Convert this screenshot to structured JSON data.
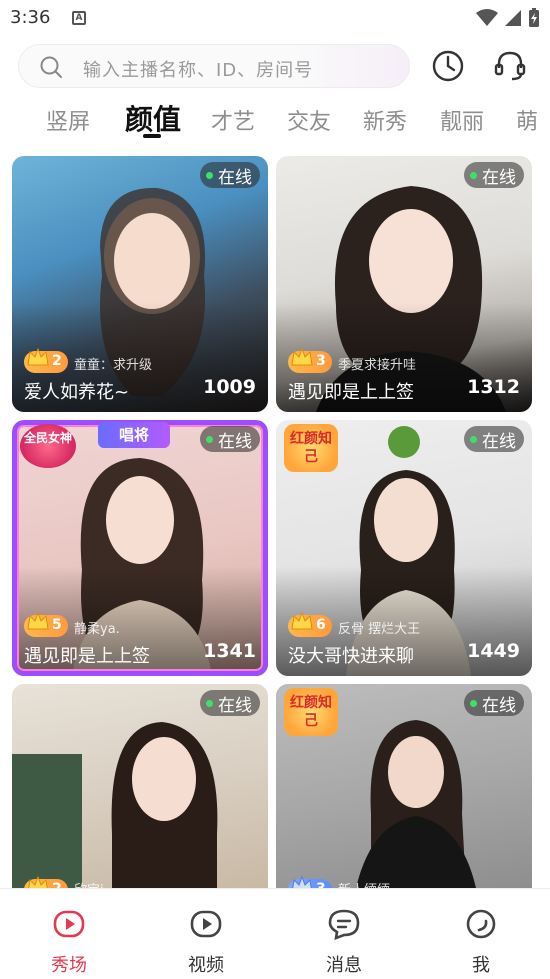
{
  "status": {
    "time": "3:36",
    "notif_icon": "A"
  },
  "search": {
    "placeholder": "输入主播名称、ID、房间号"
  },
  "tabs": [
    {
      "label": "竖屏",
      "active": false
    },
    {
      "label": "颜值",
      "active": true
    },
    {
      "label": "才艺",
      "active": false
    },
    {
      "label": "交友",
      "active": false
    },
    {
      "label": "新秀",
      "active": false
    },
    {
      "label": "靓丽",
      "active": false
    },
    {
      "label": "萌",
      "active": false
    }
  ],
  "cards": [
    {
      "online": "在线",
      "level": "2",
      "subtitle": "童童：求升级",
      "title": "爱人如养花~",
      "count": "1009"
    },
    {
      "online": "在线",
      "level": "3",
      "subtitle": "季夏求接升哇",
      "title": "遇见即是上上签",
      "count": "1312"
    },
    {
      "online": "在线",
      "level": "5",
      "subtitle": "静柔ya.",
      "title": "遇见即是上上签",
      "count": "1341",
      "tag_left": "全民女神",
      "tag_center": "唱将"
    },
    {
      "online": "在线",
      "level": "6",
      "subtitle": "反骨 摆烂大王",
      "title": "没大哥快进来聊",
      "count": "1449",
      "tag_left": "红颜知己"
    },
    {
      "online": "在线",
      "level": "2",
      "subtitle": "欣宝j"
    },
    {
      "online": "在线",
      "level": "3",
      "subtitle": "新人缅缅",
      "tag_left": "红颜知己"
    }
  ],
  "nav": [
    {
      "label": "秀场",
      "icon": "play-circle-icon",
      "active": true
    },
    {
      "label": "视频",
      "icon": "video-icon",
      "active": false
    },
    {
      "label": "消息",
      "icon": "message-icon",
      "active": false
    },
    {
      "label": "我",
      "icon": "profile-icon",
      "active": false
    }
  ],
  "colors": {
    "accent": "#e8384f",
    "online_dot": "#3ee06a",
    "level_badge": "#ffa63b"
  }
}
